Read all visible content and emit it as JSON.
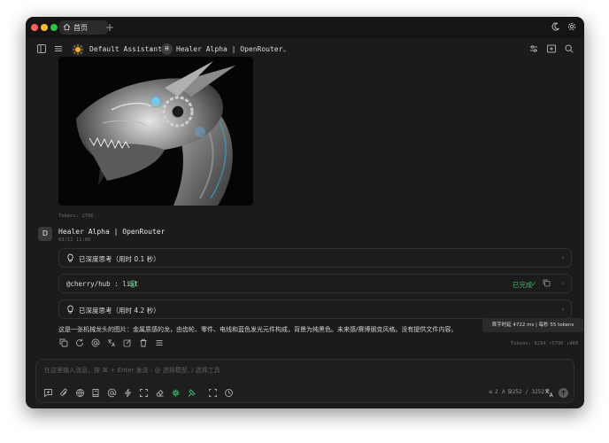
{
  "titlebar": {
    "tab_label": "首页",
    "new_tab": "+"
  },
  "toolbar": {
    "assistant_name": "Default Assistant",
    "model_initial": "H",
    "model_name": "Healer Alpha | OpenRouter"
  },
  "chat": {
    "image_tokens": "Tokens: 2766",
    "message": {
      "avatar_letter": "D",
      "sender": "Healer Alpha | OpenRouter",
      "timestamp": "03/12 11:00",
      "thinking_1": "已深度思考（用时 0.1 秒）",
      "tool_call": "@cherry/hub : list",
      "tool_status": "已完成",
      "thinking_2": "已深度思考（用时 4.2 秒）",
      "response": "这是一张机械龙头的图片：金属质感的龙，由齿轮、零件、电线和蓝色发光元件构成，背景为纯黑色。未来感/赛博朋克风格。没有提供文件内容。",
      "tokens_stats": "Tokens: 6284 ↑5796 ↓468",
      "tooltip": "首字时延 4722 ms  |  每秒 55 tokens"
    }
  },
  "input": {
    "placeholder": "在这里输入消息，按 ⌘ + Enter 发送 - @ 选择模型, / 选择工具",
    "context_count": "2 / 5",
    "token_count": "↑ 3252 / 3252"
  },
  "colors": {
    "window_bg": "#1b1b1b",
    "success_green": "#3fb36b",
    "traffic_red": "#ff5f57",
    "traffic_yellow": "#febc2e",
    "traffic_green": "#28c840"
  }
}
